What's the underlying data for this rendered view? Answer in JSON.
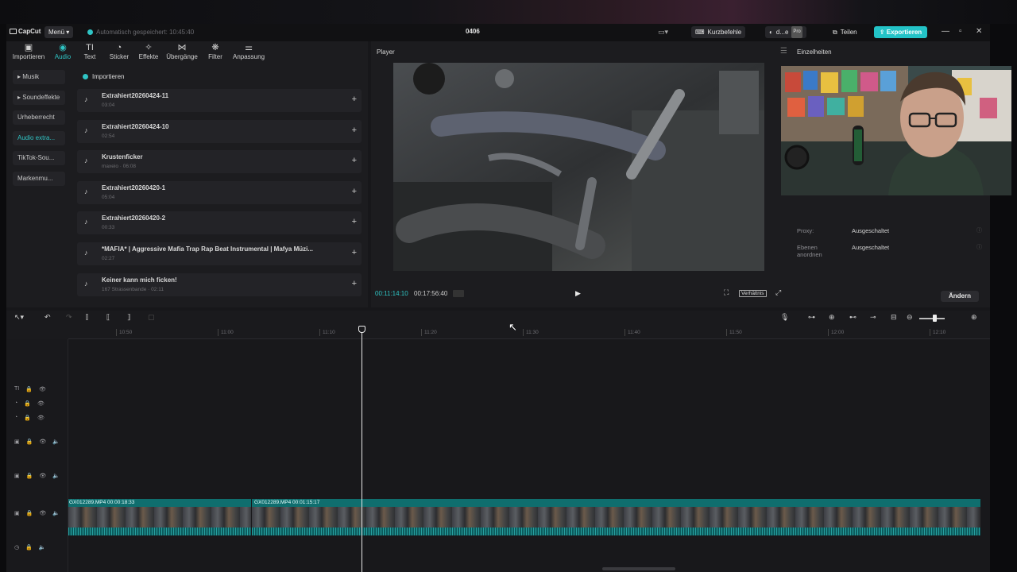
{
  "titlebar": {
    "app_name": "CapCut",
    "menu_label": "Menü",
    "autosave": "Automatisch gespeichert: 10:45:40",
    "project_title": "0406",
    "shortcuts_label": "Kurzbefehle",
    "user_label": "d...e",
    "pro_badge": "Pro",
    "share_label": "Teilen",
    "export_label": "Exportieren"
  },
  "toolbar_tabs": [
    {
      "label": "Importieren",
      "icon": "import-icon"
    },
    {
      "label": "Audio",
      "icon": "audio-icon"
    },
    {
      "label": "Text",
      "icon": "text-icon"
    },
    {
      "label": "Sticker",
      "icon": "sticker-icon"
    },
    {
      "label": "Effekte",
      "icon": "effects-icon"
    },
    {
      "label": "Übergänge",
      "icon": "transitions-icon"
    },
    {
      "label": "Filter",
      "icon": "filter-icon"
    },
    {
      "label": "Anpassung",
      "icon": "adjust-icon"
    }
  ],
  "categories": [
    "Musik",
    "Soundeffekte",
    "Urheberrecht",
    "Audio extra...",
    "TikTok-Sou...",
    "Markenmu..."
  ],
  "import_header": "Importieren",
  "files": [
    {
      "name": "Extrahiert20260424-11",
      "sub": "03:04"
    },
    {
      "name": "Extrahiert20260424-10",
      "sub": "02:54"
    },
    {
      "name": "Krustenficker",
      "sub": "maxeio · 06:08"
    },
    {
      "name": "Extrahiert20260420-1",
      "sub": "05:04"
    },
    {
      "name": "Extrahiert20260420-2",
      "sub": "00:33"
    },
    {
      "name": "*MAFIA* | Aggressive Mafia Trap Rap Beat Instrumental | Mafya Müzi...",
      "sub": "02:27"
    },
    {
      "name": "Keiner kann mich ficken!",
      "sub": "167 Strassenbande · 02:11"
    }
  ],
  "player": {
    "title": "Player",
    "current_time": "00:11:14:10",
    "total_time": "00:17:56:40",
    "ratio_label": "Verhältnis"
  },
  "details": {
    "title": "Einzelheiten",
    "rows": [
      {
        "label": "Proxy:",
        "value": "Ausgeschaltet"
      },
      {
        "label": "Ebenen anordnen",
        "value": "Ausgeschaltet"
      }
    ],
    "change_label": "Ändern"
  },
  "ruler_ticks": [
    "10:50",
    "11:00",
    "11:10",
    "11:20",
    "11:30",
    "11:40",
    "11:50",
    "12:00",
    "12:10"
  ],
  "clips": [
    {
      "label": "GX012289.MP4   00:00:18:33"
    },
    {
      "label": "GX012289.MP4   00:01:15:17"
    }
  ],
  "colors": {
    "accent": "#2fc4c4",
    "clip": "#0f6e6e",
    "export": "#23c3c7"
  }
}
